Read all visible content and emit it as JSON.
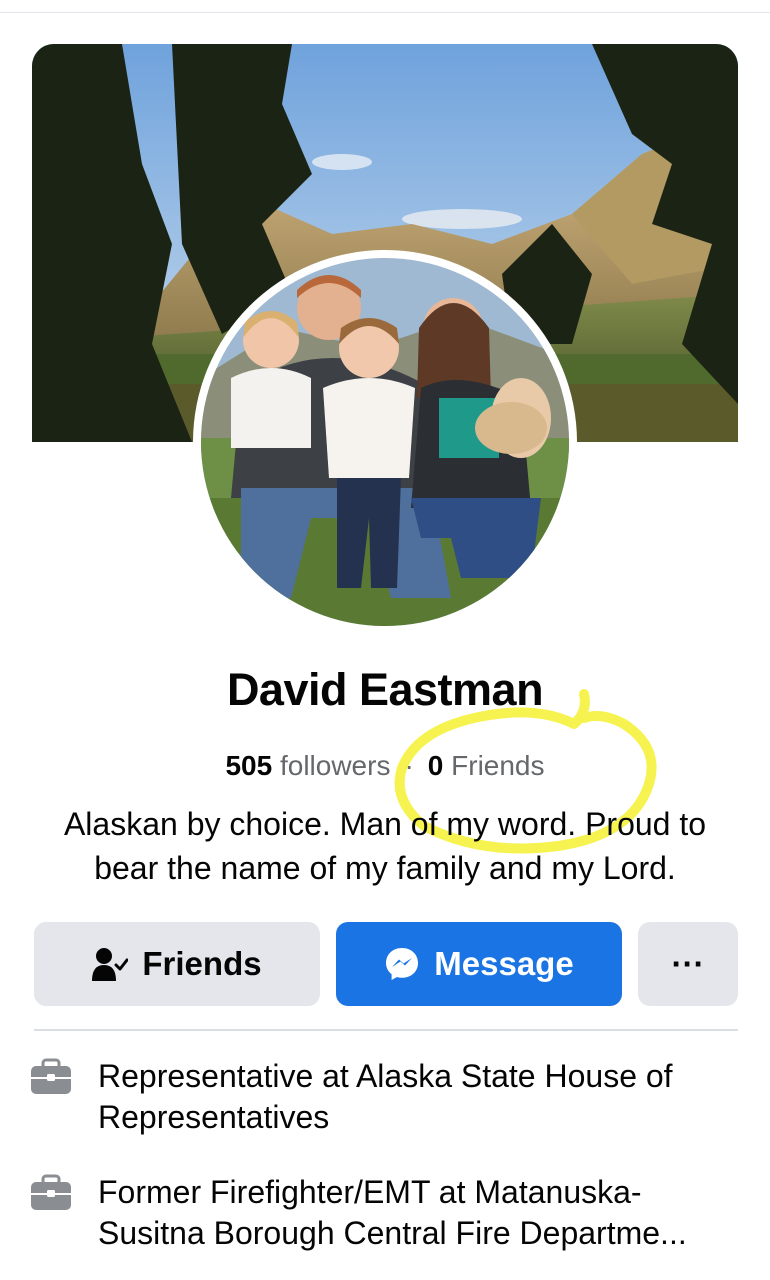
{
  "profile": {
    "name": "David Eastman",
    "followers_count": "505",
    "followers_label": "followers",
    "friends_count": "0",
    "friends_label": "Friends",
    "bio": "Alaskan by choice. Man of my word. Proud to bear the name of my family and my Lord."
  },
  "actions": {
    "friends_label": "Friends",
    "message_label": "Message",
    "more_label": "···"
  },
  "intro": [
    {
      "icon": "briefcase-icon",
      "text": "Representative at Alaska State House of Representatives"
    },
    {
      "icon": "briefcase-icon",
      "text": "Former Firefighter/EMT at Matanuska-Susitna Borough Central Fire Departme..."
    }
  ],
  "colors": {
    "primary_blue": "#1b74e4",
    "secondary_button": "#e4e6eb",
    "secondary_text": "#65676b",
    "highlight_annotation": "#f4f02a"
  }
}
